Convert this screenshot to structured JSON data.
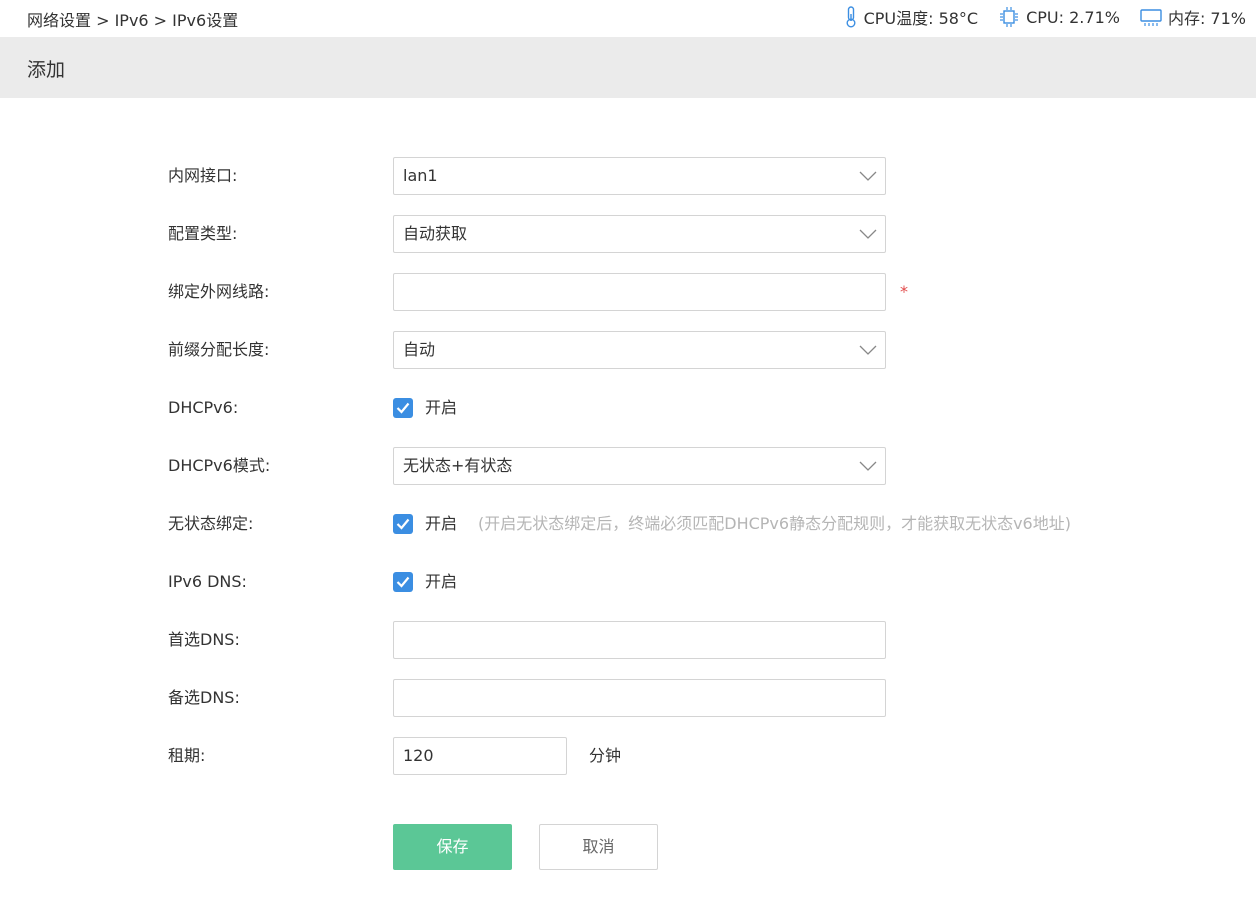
{
  "breadcrumb": "网络设置 > IPv6 > IPv6设置",
  "status": {
    "cpu_temp_label": "CPU温度: 58°C",
    "cpu_usage_label": "CPU: 2.71%",
    "memory_label": "内存: 71%"
  },
  "section_title": "添加",
  "form": {
    "lan_interface": {
      "label": "内网接口:",
      "value": "lan1"
    },
    "config_type": {
      "label": "配置类型:",
      "value": "自动获取"
    },
    "bind_wan": {
      "label": "绑定外网线路:",
      "value": "",
      "required_mark": "*"
    },
    "prefix_length": {
      "label": "前缀分配长度:",
      "value": "自动"
    },
    "dhcpv6": {
      "label": "DHCPv6:",
      "checked": true,
      "option_label": "开启"
    },
    "dhcpv6_mode": {
      "label": "DHCPv6模式:",
      "value": "无状态+有状态"
    },
    "stateless_binding": {
      "label": "无状态绑定:",
      "checked": true,
      "option_label": "开启",
      "hint": "(开启无状态绑定后，终端必须匹配DHCPv6静态分配规则，才能获取无状态v6地址)"
    },
    "ipv6_dns": {
      "label": "IPv6 DNS:",
      "checked": true,
      "option_label": "开启"
    },
    "primary_dns": {
      "label": "首选DNS:",
      "value": ""
    },
    "secondary_dns": {
      "label": "备选DNS:",
      "value": ""
    },
    "lease": {
      "label": "租期:",
      "value": "120",
      "unit": "分钟"
    }
  },
  "buttons": {
    "save": "保存",
    "cancel": "取消"
  },
  "colors": {
    "checkbox": "#3b8ee2",
    "save_button": "#5bc796",
    "header_bg": "#ebebeb",
    "required": "#e24a4a",
    "hint": "#b5b5b5"
  }
}
